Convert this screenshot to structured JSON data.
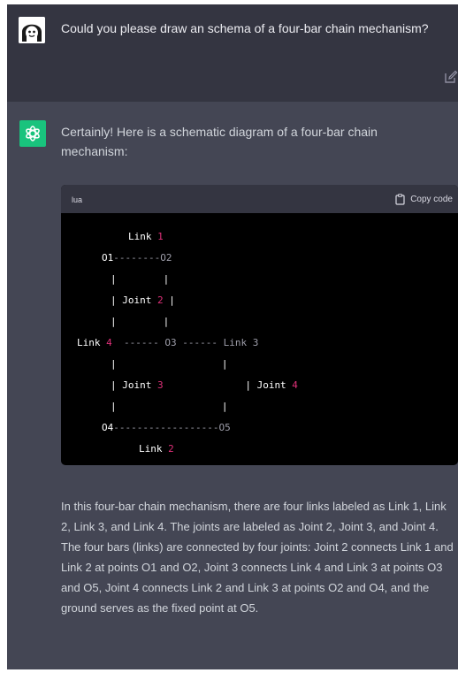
{
  "user_message": {
    "text": "Could you please draw an schema of a four-bar chain mechanism?",
    "edit_icon": "edit-icon"
  },
  "assistant_message": {
    "intro": "Certainly! Here is a schematic diagram of a four-bar chain mechanism:",
    "code_language": "lua",
    "copy_label": "Copy code",
    "code_lines": [
      {
        "name": "code-line-link1",
        "segments": [
          {
            "text": "Link",
            "color": "white"
          },
          {
            "text": " ",
            "color": "white"
          },
          {
            "text": "1",
            "color": "red"
          }
        ]
      },
      {
        "name": "code-line-o1-o2",
        "segments": [
          {
            "text": "O1",
            "color": "white"
          },
          {
            "text": "--------O2",
            "color": "grey"
          }
        ]
      },
      {
        "name": "code-line-bar-a",
        "segments": [
          {
            "text": "|",
            "color": "white"
          },
          {
            "text": "        |",
            "color": "white"
          }
        ]
      },
      {
        "name": "code-line-joint2",
        "segments": [
          {
            "text": "| ",
            "color": "white"
          },
          {
            "text": "Joint",
            "color": "white"
          },
          {
            "text": " 2",
            "color": "red"
          },
          {
            "text": " |",
            "color": "white"
          }
        ]
      },
      {
        "name": "code-line-bar-b",
        "segments": [
          {
            "text": "|",
            "color": "white"
          },
          {
            "text": "        |",
            "color": "white"
          }
        ]
      },
      {
        "name": "code-line-link4-o3-link3",
        "segments": [
          {
            "text": "Link",
            "color": "white"
          },
          {
            "text": " 4",
            "color": "red"
          },
          {
            "text": "  ------ O3 ------ Link 3",
            "color": "grey"
          }
        ]
      },
      {
        "name": "code-line-bar-c",
        "segments": [
          {
            "text": "|",
            "color": "white"
          },
          {
            "text": "                  |",
            "color": "white"
          }
        ]
      },
      {
        "name": "code-line-joint3-joint4",
        "segments": [
          {
            "text": "| Joint",
            "color": "white"
          },
          {
            "text": " 3",
            "color": "red"
          },
          {
            "text": "              | Joint",
            "color": "white"
          },
          {
            "text": " 4",
            "color": "red"
          }
        ]
      },
      {
        "name": "code-line-bar-d",
        "segments": [
          {
            "text": "|",
            "color": "white"
          },
          {
            "text": "                  |",
            "color": "white"
          }
        ]
      },
      {
        "name": "code-line-o4-o5",
        "segments": [
          {
            "text": "O4",
            "color": "white"
          },
          {
            "text": "------------------O5",
            "color": "grey"
          }
        ]
      },
      {
        "name": "code-line-link2",
        "segments": [
          {
            "text": "Link",
            "color": "white"
          },
          {
            "text": " 2",
            "color": "red"
          }
        ]
      }
    ],
    "answer": "In this four-bar chain mechanism, there are four links labeled as Link 1, Link 2, Link 3, and Link 4. The joints are labeled as Joint 2, Joint 3, and Joint 4. The four bars (links) are connected by four joints: Joint 2 connects Link 1 and Link 2 at points O1 and O2, Joint 3 connects Link 4 and Link 3 at points O3 and O5, Joint 4 connects Link 2 and Link 3 at points O2 and O4, and the ground serves as the fixed point at O5."
  },
  "colors": {
    "user_bg": "#343541",
    "assistant_bg": "#444654",
    "gpt_green": "#19c37d",
    "code_bg": "#000000",
    "code_red": "#df3079"
  }
}
